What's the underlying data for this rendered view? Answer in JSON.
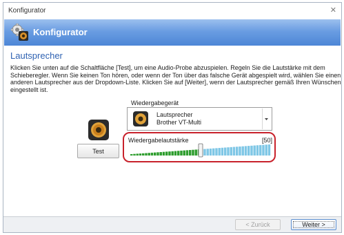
{
  "window": {
    "title": "Konfigurator"
  },
  "banner": {
    "title": "Konfigurator"
  },
  "section": {
    "title": "Lautsprecher"
  },
  "description": "Klicken Sie unten auf die Schaltfläche [Test], um eine Audio-Probe abzuspielen. Regeln Sie die Lautstärke mit dem Schieberegler. Wenn Sie keinen Ton hören, oder wenn der Ton über das falsche Gerät abgespielt wird, wählen Sie einen anderen Lautsprecher aus der Dropdown-Liste. Klicken Sie auf [Weiter], wenn der Lautsprecher gemäß Ihren Wünschen eingestellt ist.",
  "test_button": "Test",
  "playback_device": {
    "label": "Wiedergabegerät",
    "selected_line1": "Lautsprecher",
    "selected_line2": "Brother VT-Multi"
  },
  "volume": {
    "label": "Wiedergabelautstärke",
    "value_text": "[50]",
    "level": 0.5
  },
  "footer": {
    "back": "< Zurück",
    "next": "Weiter >"
  },
  "colors": {
    "banner": "#5b90da",
    "highlight": "#c8212b",
    "section_title": "#2f62b2",
    "volume_fill": "#2e9d2e",
    "volume_empty": "#7fc7e6"
  },
  "icons": {
    "app": "gear-speaker-icon",
    "speaker": "speaker-icon",
    "close": "close-icon"
  }
}
